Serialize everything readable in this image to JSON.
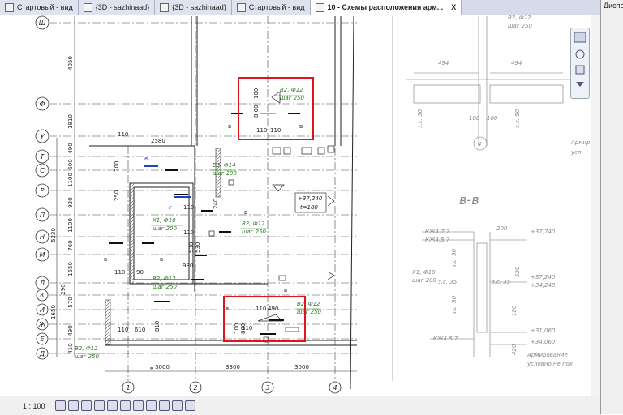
{
  "tabs": [
    {
      "label": "Стартовый - вид",
      "active": false
    },
    {
      "label": "{3D - sazhinaad}",
      "active": false
    },
    {
      "label": "{3D - sazhinaad}",
      "active": false
    },
    {
      "label": "Стартовый - вид",
      "active": false
    },
    {
      "label": "10 - Схемы расположения арм...",
      "active": true
    }
  ],
  "close_label": "X",
  "right_panel": {
    "title": "Диспе"
  },
  "status": {
    "scale": "1 : 100"
  },
  "plan": {
    "axes_rows": [
      "Ш",
      "Ф",
      "У",
      "Т",
      "С",
      "Р",
      "П",
      "Н",
      "М",
      "Л",
      "К",
      "И",
      "Ж",
      "Е",
      "Д"
    ],
    "axes_cols": [
      "1",
      "2",
      "3",
      "4"
    ],
    "dims_left": [
      "4050",
      "1910",
      "490",
      "600",
      "1100",
      "920",
      "1100",
      "5230",
      "760",
      "1650",
      "290",
      "1650",
      "570",
      "490",
      "410"
    ],
    "dims_bottom": [
      "3000",
      "3300",
      "3000"
    ],
    "labels": {
      "b2_top": "В2, Ф12",
      "b2_top_step": "шаг 250",
      "b3": "В3, Ф14",
      "b3_step": "шаг 100",
      "x1": "Х1, Ф10",
      "x1_step": "шаг 200",
      "b2_mid": "В2, Ф12",
      "b2_mid_step": "шаг 250",
      "b2_left": "В2, Ф12",
      "b2_left_step": "шаг 250",
      "b2_low": "В2, Ф12",
      "b2_low_step": "шаг 250",
      "b2_bot": "В2, Ф12",
      "b2_bot_step": "шаг 250",
      "elev": "+37,240",
      "thick": "t=180",
      "d2580": "2580",
      "d110a": "110",
      "d200": "200",
      "d250": "250",
      "d110b": "110",
      "d240": "240",
      "d530": "530",
      "d530b": "530",
      "d980": "980",
      "d90": "90",
      "d110c": "110",
      "d110d": "110",
      "d610": "610",
      "d110e": "110",
      "d810": "810",
      "d110f": "110",
      "d110g": "110",
      "d490": "490",
      "d8_00": "8,00",
      "d100": "100",
      "d110t": "110",
      "d110u": "110",
      "d100b": "100",
      "d880": "880",
      "mark_b": "в",
      "mark_g": "г"
    }
  },
  "details": {
    "top_label": "В2, Ф12",
    "top_step": "шаг 250",
    "d494a": "494",
    "d494b": "494",
    "d100a": "100",
    "d100b": "100",
    "zs50a": "з.с. 50",
    "zs50b": "з.с. 50",
    "axis4": "4",
    "armir_top": "Армир",
    "armir_top2": "усл",
    "section_title": "в-в",
    "kx1": "КЖ4.7.7",
    "kx2": "КЖ4.5.7",
    "kx3": "КЖ4.5.7",
    "d200": "200",
    "d520": "520",
    "d180": "180",
    "d420": "420",
    "zs30a": "з.с. 30",
    "zs35a": "з.с. 35",
    "zs35b": "з.с. 35",
    "zs30b": "з.с. 30",
    "x1": "Х1, Ф10",
    "x1_step": "шаг 200",
    "e1": "+37,740",
    "e2": "+37,240",
    "e3": "+34,240",
    "e4": "+31,060",
    "e5": "+34,060",
    "armir_bot": "Армирование",
    "armir_bot2": "условно не пок"
  }
}
